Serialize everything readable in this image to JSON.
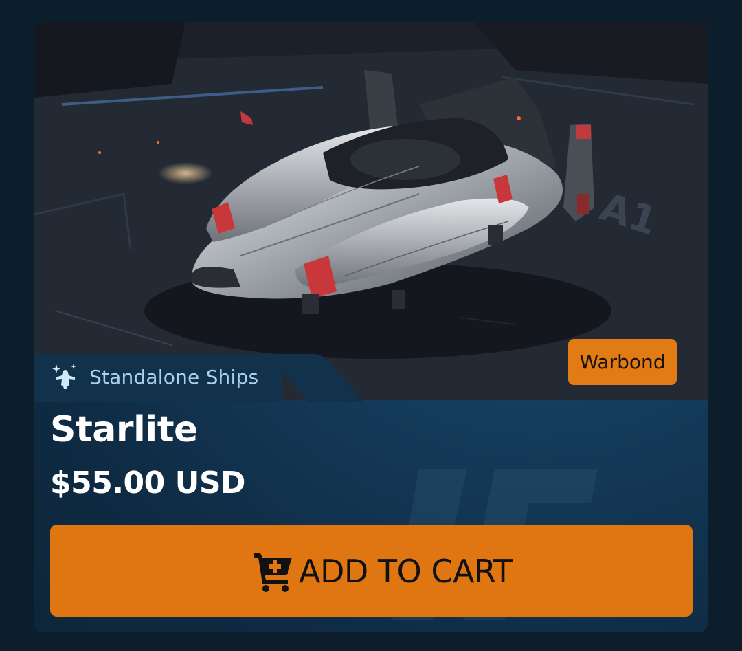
{
  "product": {
    "category": "Standalone Ships",
    "badge": "Warbond",
    "name": "Starlite",
    "price": "$55.00 USD"
  },
  "actions": {
    "add_to_cart_label": "ADD TO CART"
  },
  "icons": {
    "category": "ship-sparkle-icon",
    "cart": "cart-plus-icon"
  },
  "colors": {
    "page_background": "#0c1e2c",
    "card_background": "#164062",
    "accent_orange": "#e07612",
    "category_text": "#a9d3ec",
    "title_text": "#ffffff"
  }
}
